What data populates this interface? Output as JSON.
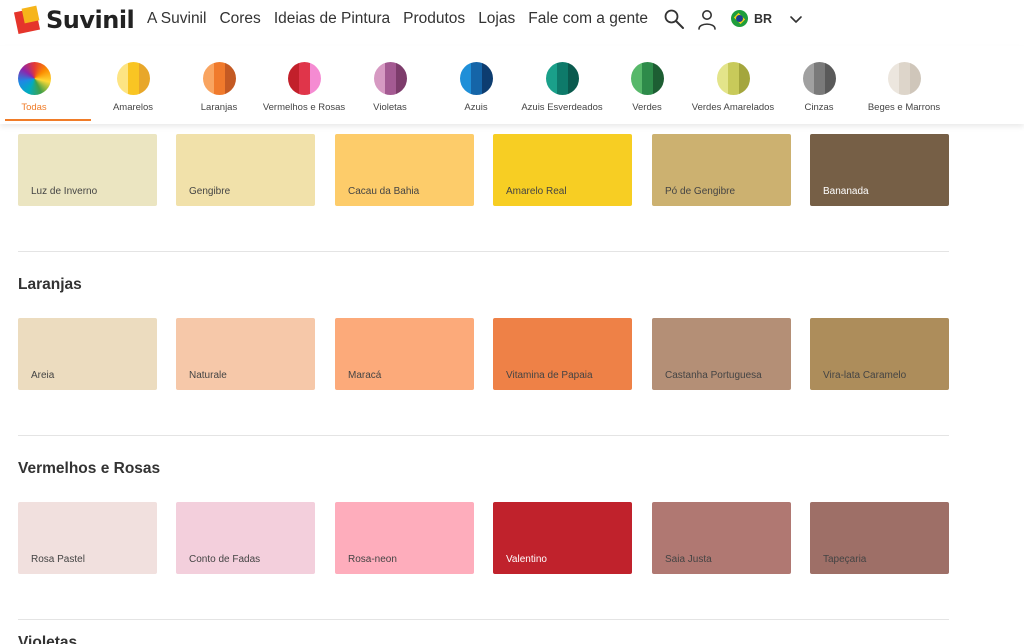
{
  "brand": {
    "name": "Suvinil"
  },
  "nav": {
    "items": [
      "A Suvinil",
      "Cores",
      "Ideias de Pintura",
      "Produtos",
      "Lojas",
      "Fale com a gente"
    ]
  },
  "header": {
    "lang": "BR",
    "icons": [
      "search-icon",
      "user-icon",
      "brazil-flag-icon",
      "chevron-down-icon"
    ]
  },
  "categories": [
    {
      "label": "Todas",
      "active": true,
      "colors": [
        "wheel"
      ]
    },
    {
      "label": "Amarelos",
      "colors": [
        "#fde483",
        "#f9c523",
        "#e8a72a"
      ]
    },
    {
      "label": "Laranjas",
      "colors": [
        "#f9a460",
        "#f07a2c",
        "#c45a23"
      ]
    },
    {
      "label": "Vermelhos e Rosas",
      "colors": [
        "#c2202b",
        "#e0354a",
        "#f58bd2"
      ]
    },
    {
      "label": "Violetas",
      "colors": [
        "#d699c2",
        "#a45a92",
        "#7d3c6b"
      ]
    },
    {
      "label": "Azuis",
      "colors": [
        "#1f8fd8",
        "#1565a8",
        "#0d3d70"
      ]
    },
    {
      "label": "Azuis Esverdeados",
      "colors": [
        "#1aa08a",
        "#0e7a6a",
        "#0a5a4e"
      ]
    },
    {
      "label": "Verdes",
      "colors": [
        "#57b86a",
        "#2e8b4a",
        "#1d5e33"
      ]
    },
    {
      "label": "Verdes Amarelados",
      "colors": [
        "#e3e48a",
        "#c8ca5a",
        "#a4a63d"
      ]
    },
    {
      "label": "Cinzas",
      "colors": [
        "#a0a0a0",
        "#7a7a7a",
        "#5a5a5a"
      ]
    },
    {
      "label": "Beges e Marrons",
      "colors": [
        "#ece6de",
        "#ddd5ca",
        "#cfc6ba"
      ]
    }
  ],
  "sections": [
    {
      "title": "",
      "colors": [
        {
          "name": "Luz de Inverno",
          "hex": "#ebe5c1",
          "dark": false
        },
        {
          "name": "Gengibre",
          "hex": "#f1e1aa",
          "dark": false
        },
        {
          "name": "Cacau da Bahia",
          "hex": "#fdcc6a",
          "dark": false
        },
        {
          "name": "Amarelo Real",
          "hex": "#f7ce23",
          "dark": false
        },
        {
          "name": "Pó de Gengibre",
          "hex": "#ccb170",
          "dark": false
        },
        {
          "name": "Bananada",
          "hex": "#765f46",
          "dark": true
        }
      ]
    },
    {
      "title": "Laranjas",
      "colors": [
        {
          "name": "Areia",
          "hex": "#ecdcbf",
          "dark": false
        },
        {
          "name": "Naturale",
          "hex": "#f6c8a9",
          "dark": false
        },
        {
          "name": "Maracá",
          "hex": "#fcaa7a",
          "dark": false
        },
        {
          "name": "Vitamina de Papaia",
          "hex": "#ee8147",
          "dark": false
        },
        {
          "name": "Castanha Portuguesa",
          "hex": "#b48f76",
          "dark": false
        },
        {
          "name": "Vira-lata Caramelo",
          "hex": "#ad8d5b",
          "dark": false
        }
      ]
    },
    {
      "title": "Vermelhos e Rosas",
      "colors": [
        {
          "name": "Rosa Pastel",
          "hex": "#f1e0de",
          "dark": false
        },
        {
          "name": "Conto de Fadas",
          "hex": "#f3cfdc",
          "dark": false
        },
        {
          "name": "Rosa-neon",
          "hex": "#feadbc",
          "dark": false
        },
        {
          "name": "Valentino",
          "hex": "#c0222c",
          "dark": true
        },
        {
          "name": "Saia Justa",
          "hex": "#b07872",
          "dark": false
        },
        {
          "name": "Tapeçaria",
          "hex": "#9e6f67",
          "dark": false
        }
      ]
    }
  ],
  "next_section_title": "Violetas",
  "accent": "#f07c28"
}
